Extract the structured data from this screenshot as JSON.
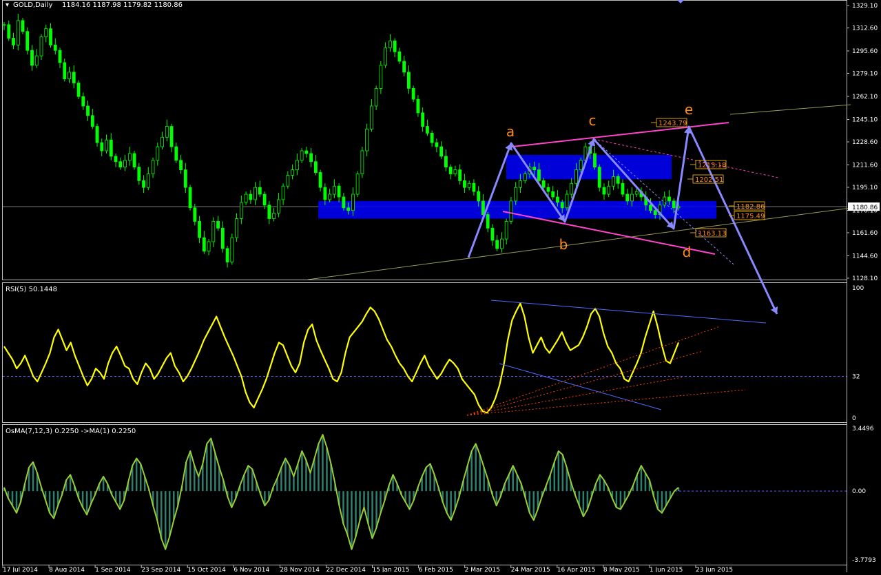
{
  "header": {
    "symbol": "GOLD,Daily",
    "ohlc": "1184.16 1187.98 1179.82 1180.86"
  },
  "colors": {
    "background": "#000000",
    "candle": "#00ff00",
    "rsi_line": "#ffff00",
    "osma_line": "#9acd32",
    "osma_fill": "#2f7f6f",
    "wave_arrow": "#8888ff",
    "channel": "#ff44cc",
    "zone": "#0000ff",
    "wave_label": "#ff8c1a",
    "level_box": "#d4a017",
    "trend_line": "#999955"
  },
  "chart_data": [
    {
      "type": "candlestick",
      "title": "GOLD,Daily",
      "ohlc_last": {
        "open": 1184.16,
        "high": 1187.98,
        "low": 1179.82,
        "close": 1180.86
      },
      "ylim": [
        1128.1,
        1329.1
      ],
      "y_ticks": [
        "1329.10",
        "1312.60",
        "1295.60",
        "1279.10",
        "1262.10",
        "1245.10",
        "1228.60",
        "1211.60",
        "1195.10",
        "1178.10",
        "1161.60",
        "1144.60",
        "1128.10"
      ],
      "current_price": "1180.86",
      "x_ticks": [
        "17 Jul 2014",
        "8 Aug 2014",
        "1 Sep 2014",
        "23 Sep 2014",
        "15 Oct 2014",
        "6 Nov 2014",
        "28 Nov 2014",
        "22 Dec 2014",
        "15 Jan 2015",
        "6 Feb 2015",
        "2 Mar 2015",
        "24 Mar 2015",
        "16 Apr 2015",
        "8 May 2015",
        "1 Jun 2015",
        "23 Jun 2015"
      ],
      "close_series": [
        1315,
        1305,
        1300,
        1318,
        1310,
        1296,
        1285,
        1292,
        1306,
        1312,
        1300,
        1296,
        1287,
        1275,
        1280,
        1272,
        1262,
        1255,
        1248,
        1240,
        1228,
        1222,
        1230,
        1218,
        1214,
        1210,
        1215,
        1220,
        1210,
        1200,
        1195,
        1205,
        1215,
        1225,
        1232,
        1240,
        1225,
        1215,
        1208,
        1195,
        1180,
        1170,
        1158,
        1148,
        1155,
        1170,
        1165,
        1150,
        1140,
        1158,
        1172,
        1184,
        1190,
        1186,
        1195,
        1190,
        1182,
        1172,
        1176,
        1186,
        1196,
        1204,
        1208,
        1215,
        1222,
        1220,
        1214,
        1206,
        1195,
        1186,
        1190,
        1196,
        1188,
        1180,
        1178,
        1190,
        1205,
        1222,
        1238,
        1255,
        1268,
        1285,
        1298,
        1303,
        1295,
        1288,
        1280,
        1268,
        1260,
        1250,
        1240,
        1235,
        1228,
        1225,
        1218,
        1210,
        1205,
        1208,
        1200,
        1195,
        1198,
        1192,
        1185,
        1175,
        1165,
        1156,
        1150,
        1157,
        1170,
        1185,
        1195,
        1200,
        1205,
        1210,
        1208,
        1200,
        1195,
        1192,
        1188,
        1184,
        1180,
        1190,
        1198,
        1208,
        1215,
        1225,
        1220,
        1210,
        1195,
        1190,
        1196,
        1203,
        1198,
        1190,
        1185,
        1190,
        1192,
        1188,
        1182,
        1178,
        1175,
        1182,
        1188,
        1185,
        1180,
        1181
      ],
      "annotations": {
        "wave_labels": [
          "a",
          "b",
          "c",
          "d",
          "e"
        ],
        "price_levels": [
          "1243.79",
          "1213.18",
          "1202.51",
          "1182.86",
          "1175.49",
          "1163.13"
        ]
      }
    },
    {
      "type": "line",
      "title": "RSI(5) 50.1448",
      "ylim": [
        0,
        100
      ],
      "y_ticks": [
        "100",
        "32",
        "0"
      ],
      "level": 32,
      "series": [
        {
          "name": "RSI(5)",
          "values": [
            55,
            50,
            45,
            38,
            42,
            48,
            40,
            32,
            28,
            35,
            42,
            50,
            62,
            68,
            60,
            52,
            58,
            48,
            40,
            32,
            25,
            30,
            38,
            35,
            30,
            42,
            50,
            55,
            48,
            40,
            38,
            30,
            26,
            35,
            42,
            38,
            30,
            34,
            40,
            46,
            50,
            40,
            35,
            28,
            32,
            38,
            45,
            52,
            60,
            66,
            72,
            78,
            70,
            62,
            55,
            48,
            40,
            32,
            20,
            12,
            8,
            15,
            22,
            30,
            40,
            50,
            58,
            56,
            48,
            40,
            35,
            42,
            58,
            68,
            72,
            60,
            52,
            45,
            38,
            30,
            28,
            35,
            50,
            62,
            66,
            70,
            74,
            80,
            85,
            82,
            76,
            68,
            60,
            55,
            48,
            42,
            38,
            32,
            28,
            35,
            42,
            48,
            40,
            35,
            30,
            34,
            40,
            45,
            42,
            38,
            30,
            26,
            22,
            18,
            10,
            5,
            4,
            8,
            15,
            25,
            40,
            60,
            75,
            82,
            88,
            78,
            62,
            50,
            56,
            62,
            54,
            50,
            55,
            60,
            66,
            58,
            52,
            54,
            56,
            62,
            70,
            80,
            84,
            78,
            65,
            55,
            50,
            42,
            38,
            30,
            28,
            35,
            42,
            50,
            62,
            72,
            82,
            70,
            56,
            44,
            42,
            50,
            58
          ]
        }
      ]
    },
    {
      "type": "bar",
      "title": "OsMA(7,12,3) 0.2250 ->MA(1) 0.2250",
      "ylim": [
        -3.7793,
        3.4496
      ],
      "y_ticks": [
        "3.4496",
        "0.00",
        "-3.7793"
      ],
      "series": [
        {
          "name": "OsMA(7,12,3)",
          "values": [
            0.2,
            -0.4,
            -0.8,
            -1.2,
            -0.6,
            0.4,
            1.3,
            1.6,
            1.0,
            0.2,
            -0.5,
            -1.2,
            -1.5,
            -0.8,
            -0.2,
            0.6,
            0.9,
            0.3,
            -0.4,
            -0.9,
            -1.3,
            -0.7,
            -0.2,
            0.4,
            0.8,
            0.4,
            -0.2,
            -0.6,
            -1.0,
            -0.5,
            0.5,
            1.4,
            1.8,
            1.5,
            0.8,
            0.1,
            -0.8,
            -1.6,
            -2.6,
            -3.2,
            -2.5,
            -1.6,
            -0.8,
            0.3,
            1.6,
            2.2,
            1.4,
            0.8,
            1.5,
            2.6,
            2.9,
            2.1,
            1.3,
            0.6,
            -0.3,
            -0.9,
            -0.4,
            0.3,
            0.9,
            1.4,
            1.2,
            0.5,
            -0.2,
            -0.8,
            -0.5,
            0.2,
            0.7,
            1.3,
            1.8,
            1.4,
            0.8,
            1.5,
            2.2,
            1.7,
            1.0,
            1.8,
            2.6,
            3.1,
            2.4,
            1.5,
            0.4,
            -0.8,
            -1.8,
            -2.4,
            -3.2,
            -2.5,
            -1.6,
            -0.9,
            -1.8,
            -2.6,
            -2.0,
            -1.2,
            -0.5,
            0.3,
            0.9,
            0.4,
            -0.2,
            -0.6,
            -1.0,
            -0.5,
            0.2,
            0.8,
            1.3,
            1.5,
            0.9,
            0.2,
            -0.6,
            -1.2,
            -1.6,
            -1.0,
            -0.3,
            0.6,
            1.4,
            2.2,
            2.6,
            2.0,
            1.3,
            0.6,
            -0.2,
            -0.8,
            -0.3,
            0.4,
            0.9,
            1.4,
            0.9,
            0.4,
            -0.4,
            -1.2,
            -1.6,
            -1.0,
            -0.3,
            0.3,
            0.9,
            1.6,
            2.2,
            2.0,
            1.3,
            0.5,
            -0.2,
            -0.8,
            -1.4,
            -1.0,
            -0.3,
            0.4,
            0.9,
            0.6,
            0.2,
            -0.4,
            -0.9,
            -1.0,
            -0.6,
            -0.2,
            0.3,
            0.9,
            1.4,
            1.0,
            0.6,
            -0.3,
            -1.0,
            -1.2,
            -0.8,
            -0.4,
            0.0,
            0.2
          ]
        }
      ]
    }
  ]
}
